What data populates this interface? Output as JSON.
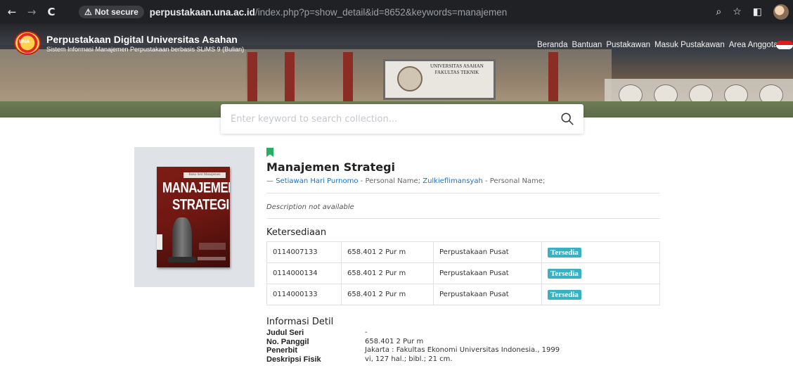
{
  "browser": {
    "back": "←",
    "forward": "→",
    "reload": "C",
    "security_label": "Not secure",
    "url_host": "perpustakaan.una.ac.id",
    "url_rest": "/index.php?p=show_detail&id=8652&keywords=manajemen"
  },
  "site": {
    "logo_text": "UNA",
    "title": "Perpustakaan Digital Universitas Asahan",
    "subtitle": "Sistem Informasi Manajemen Perpustakaan berbasis SLiMS 9 (Bulian)",
    "banner_sign": "UNIVERSITAS ASAHAN\nFAKULTAS TEKNIK",
    "nav": [
      "Beranda",
      "Bantuan",
      "Pustakawan",
      "Masuk Pustakawan",
      "Area Anggota"
    ]
  },
  "search": {
    "placeholder": "Enter keyword to search collection..."
  },
  "book": {
    "cover_series": "Buku Seri Manajemen",
    "cover_title_line1": "MANAJEMEN",
    "cover_title_line2": "STRATEGI",
    "title": "Manajemen Strategi",
    "authors_prefix": "— ",
    "author1": "Setiawan Hari Purnomo",
    "author1_role": " - Personal Name; ",
    "author2": "Zulkieflimansyah",
    "author2_role": " - Personal Name;",
    "description": "Description not available"
  },
  "availability": {
    "heading": "Ketersediaan",
    "rows": [
      {
        "item_code": "0114007133",
        "call_number": "658.401 2 Pur m",
        "location": "Perpustakaan Pusat",
        "status": "Tersedia"
      },
      {
        "item_code": "0114000134",
        "call_number": "658.401 2 Pur m",
        "location": "Perpustakaan Pusat",
        "status": "Tersedia"
      },
      {
        "item_code": "0114000133",
        "call_number": "658.401 2 Pur m",
        "location": "Perpustakaan Pusat",
        "status": "Tersedia"
      }
    ],
    "status_color": "#3ab0c3"
  },
  "details": {
    "heading": "Informasi Detil",
    "rows": [
      {
        "label": "Judul Seri",
        "value": "-"
      },
      {
        "label": "No. Panggil",
        "value": "658.401 2 Pur m"
      },
      {
        "label": "Penerbit",
        "value": "Jakarta : Fakultas Ekonomi Universitas Indonesia., 1999"
      },
      {
        "label": "Deskripsi Fisik",
        "value": "vi, 127 hal.; bibl.; 21 cm."
      }
    ]
  }
}
